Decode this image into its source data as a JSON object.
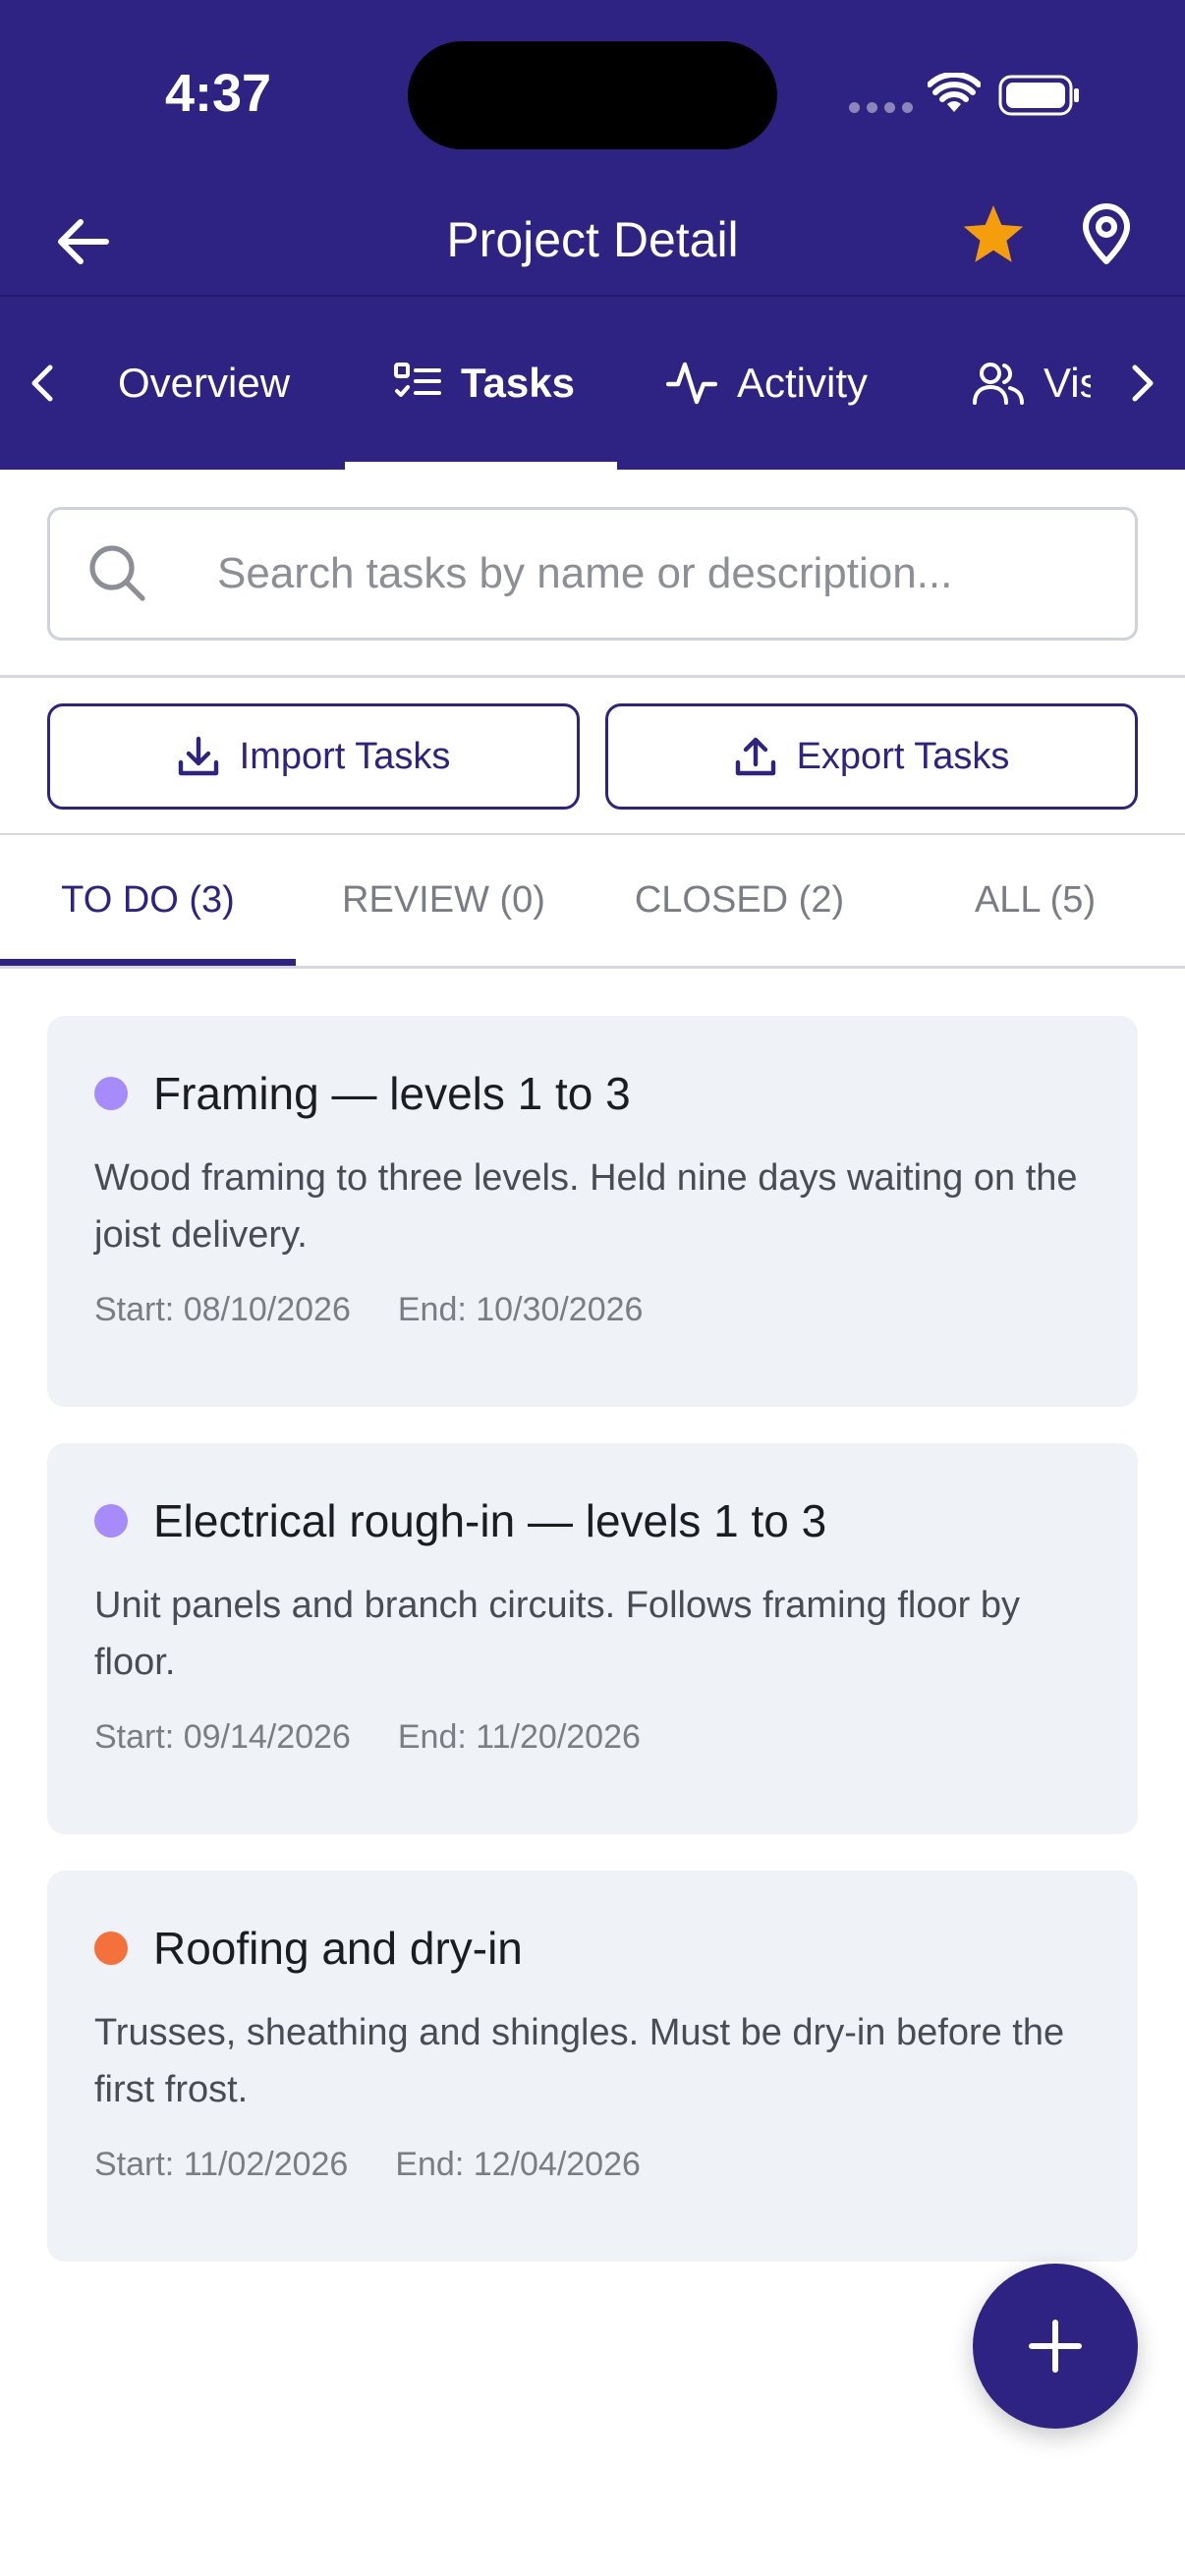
{
  "theme": {
    "brand": "#2e2282",
    "star": "#f59e0b",
    "dot_purple": "#a78bfa",
    "dot_orange": "#f4713b"
  },
  "status_bar": {
    "time": "4:37"
  },
  "header": {
    "title": "Project Detail",
    "back_icon": "arrow-left-icon",
    "star_icon": "star-icon",
    "pin_icon": "map-pin-icon"
  },
  "nav_tabs": [
    {
      "label": "Overview",
      "icon": ""
    },
    {
      "label": "Tasks",
      "icon": "checklist-icon"
    },
    {
      "label": "Activity",
      "icon": "activity-icon"
    },
    {
      "label": "Visitors",
      "icon": "users-icon"
    }
  ],
  "search": {
    "placeholder": "Search tasks by name or description...",
    "value": ""
  },
  "actions": {
    "import_label": "Import Tasks",
    "export_label": "Export Tasks"
  },
  "status_tabs": [
    {
      "label": "TO DO (3)"
    },
    {
      "label": "REVIEW (0)"
    },
    {
      "label": "CLOSED (2)"
    },
    {
      "label": "ALL (5)"
    }
  ],
  "tasks": [
    {
      "title": "Framing — levels 1 to 3",
      "description": "Wood framing to three levels. Held nine days waiting on the joist delivery.",
      "start": "Start: 08/10/2026",
      "end": "End: 10/30/2026",
      "dot": "#a78bfa"
    },
    {
      "title": "Electrical rough-in — levels 1 to 3",
      "description": "Unit panels and branch circuits. Follows framing floor by floor.",
      "start": "Start: 09/14/2026",
      "end": "End: 11/20/2026",
      "dot": "#a78bfa"
    },
    {
      "title": "Roofing and dry-in",
      "description": "Trusses, sheathing and shingles. Must be dry-in before the first frost.",
      "start": "Start: 11/02/2026",
      "end": "End: 12/04/2026",
      "dot": "#f4713b"
    }
  ]
}
